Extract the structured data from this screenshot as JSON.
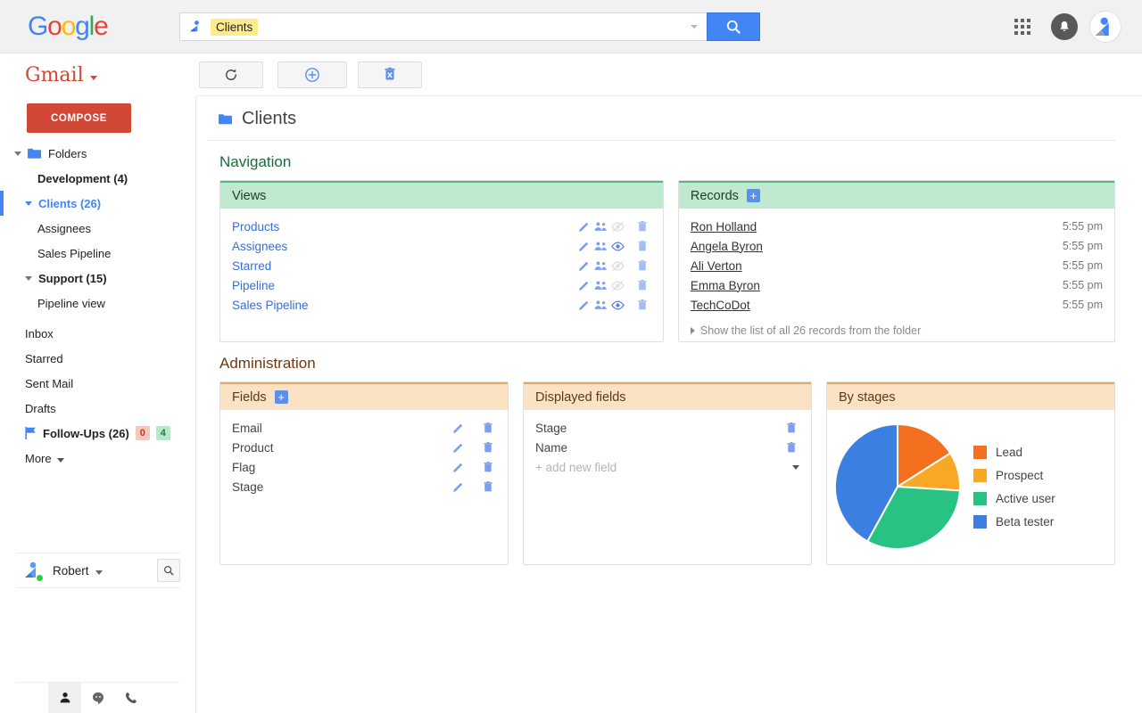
{
  "topbar": {
    "logo": "Google",
    "logo_letters": [
      "G",
      "o",
      "o",
      "g",
      "l",
      "e"
    ],
    "search": {
      "chip": "Clients",
      "value": "",
      "placeholder": "",
      "icon": "contact-search-icon"
    },
    "search_button_icon": "search-icon",
    "apps_icon": "apps-grid-icon",
    "notifications_icon": "bell-icon",
    "profile_icon": "profile-avatar-icon"
  },
  "sidebar": {
    "brand": "Gmail",
    "compose_label": "COMPOSE",
    "items": [
      {
        "label": "Folders",
        "type": "group",
        "expanded": true,
        "icon": "folder-icon"
      },
      {
        "label": "Development (4)",
        "type": "child-bold"
      },
      {
        "label": "Clients (26)",
        "type": "group-child",
        "expanded": true,
        "selected": true
      },
      {
        "label": "Assignees",
        "type": "subchild"
      },
      {
        "label": "Sales Pipeline",
        "type": "subchild"
      },
      {
        "label": "Support (15)",
        "type": "group-child-bold",
        "expanded": true
      },
      {
        "label": "Pipeline view",
        "type": "subchild"
      },
      {
        "label": "Inbox",
        "type": "plain"
      },
      {
        "label": "Starred",
        "type": "plain"
      },
      {
        "label": "Sent Mail",
        "type": "plain"
      },
      {
        "label": "Drafts",
        "type": "plain"
      },
      {
        "label": "Follow-Ups (26)",
        "type": "flag",
        "badge_red": "0",
        "badge_green": "4"
      },
      {
        "label": "More",
        "type": "more"
      }
    ],
    "user": {
      "name": "Robert",
      "status": "online",
      "search_icon": "search-icon",
      "avatar_icon": "profile-avatar-icon"
    },
    "bottom_tabs": [
      {
        "name": "contacts-tab",
        "icon": "person-icon",
        "active": true
      },
      {
        "name": "chats-tab",
        "icon": "chat-icon",
        "active": false
      },
      {
        "name": "calls-tab",
        "icon": "phone-icon",
        "active": false
      }
    ]
  },
  "toolbar": {
    "buttons": [
      {
        "name": "refresh-button",
        "icon": "refresh-icon"
      },
      {
        "name": "add-button",
        "icon": "plus-circle-icon"
      },
      {
        "name": "delete-button",
        "icon": "trash-x-icon"
      }
    ]
  },
  "page": {
    "title": "Clients",
    "folder_icon": "folder-icon",
    "sections": [
      {
        "title": "Navigation"
      },
      {
        "title": "Administration"
      }
    ]
  },
  "views_panel": {
    "header": "Views",
    "rows": [
      {
        "label": "Products",
        "visible": false
      },
      {
        "label": "Assignees",
        "visible": true
      },
      {
        "label": "Starred",
        "visible": false
      },
      {
        "label": "Pipeline",
        "visible": false
      },
      {
        "label": "Sales Pipeline",
        "visible": true
      }
    ],
    "row_icons": [
      "pencil-icon",
      "people-icon",
      "eye-icon",
      "trash-icon"
    ]
  },
  "records_panel": {
    "header": "Records",
    "add_label": "+",
    "rows": [
      {
        "name": "Ron Holland",
        "time": "5:55 pm"
      },
      {
        "name": "Angela Byron",
        "time": "5:55 pm"
      },
      {
        "name": "Ali Verton",
        "time": "5:55 pm"
      },
      {
        "name": "Emma Byron",
        "time": "5:55 pm"
      },
      {
        "name": "TechCoDot",
        "time": "5:55 pm"
      }
    ],
    "show_all": "Show the list of all 26 records from the folder"
  },
  "fields_panel": {
    "header": "Fields",
    "add_label": "+",
    "rows": [
      {
        "label": "Email"
      },
      {
        "label": "Product"
      },
      {
        "label": "Flag"
      },
      {
        "label": "Stage"
      }
    ]
  },
  "displayed_fields_panel": {
    "header": "Displayed fields",
    "rows": [
      {
        "label": "Stage"
      },
      {
        "label": "Name"
      }
    ],
    "add_new": "+ add new field"
  },
  "chart_panel": {
    "header": "By stages"
  },
  "chart_data": {
    "type": "pie",
    "title": "By stages",
    "legend_position": "right",
    "categories": [
      "Lead",
      "Prospect",
      "Active user",
      "Beta tester"
    ],
    "values": [
      16,
      10,
      32,
      42
    ],
    "colors": [
      "#f4701f",
      "#f9a825",
      "#28c283",
      "#3b7fe0"
    ],
    "units": "percent"
  },
  "colors": {
    "google_blue": "#4285F4",
    "google_red": "#EA4335",
    "google_yellow": "#FBBC05",
    "google_green": "#34A853",
    "gmail_red": "#d14836",
    "panel_green": "#bfeacf",
    "panel_orange": "#fbe2c4",
    "link_blue": "#3a6fcc",
    "icon_blue": "#7d9ff0",
    "section_green": "#1a6b3c",
    "section_brown": "#6b3a13"
  }
}
